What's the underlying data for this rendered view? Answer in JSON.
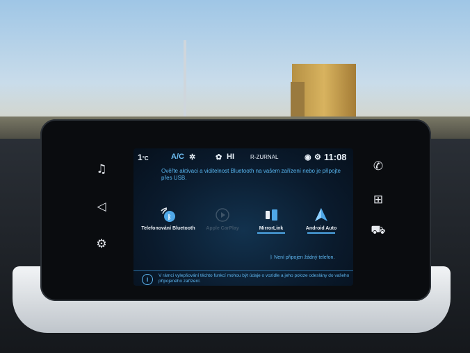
{
  "status_bar": {
    "temperature": "1",
    "temperature_unit": "°C",
    "ac_label": "A/C",
    "fan_level": "HI",
    "radio_station": "R-ZURNAL",
    "time": "11:08"
  },
  "message": "Ověřte aktivaci a viditelnost Bluetooth na vašem zařízení nebo je připojte přes USB.",
  "apps": [
    {
      "label": "Telefonování Bluetooth",
      "icon": "bluetooth-phone-icon",
      "active": true
    },
    {
      "label": "Apple CarPlay",
      "icon": "carplay-icon",
      "active": false
    },
    {
      "label": "MirrorLink",
      "icon": "mirrorlink-icon",
      "active": true
    },
    {
      "label": "Android Auto",
      "icon": "android-auto-icon",
      "active": true
    }
  ],
  "connection_status": "Není připojen žádný telefon.",
  "footer_note": "V rámci vylepšování těchto funkcí mohou být údaje o vozidle a jeho poloze odeslány do vašeho připojeného zařízení.",
  "left_buttons": [
    "music-note-icon",
    "navigation-icon",
    "car-settings-icon"
  ],
  "right_buttons": [
    "phone-icon",
    "apps-grid-icon",
    "vehicle-icon"
  ],
  "colors": {
    "accent": "#4fa8e8",
    "screen_bg": "#0a1a2c"
  }
}
